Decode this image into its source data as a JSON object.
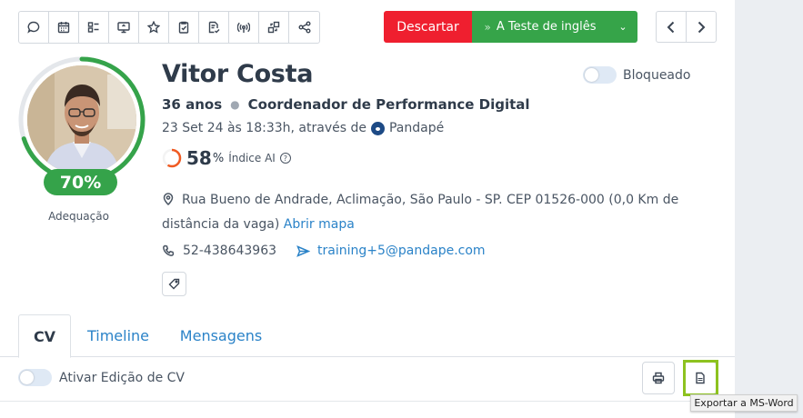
{
  "toolbar": {
    "icons": [
      "chat-icon",
      "calendar-icon",
      "checklist-icon",
      "screen-share-icon",
      "star-icon",
      "clipboard-check-icon",
      "document-check-icon",
      "signal-icon",
      "transfer-icon",
      "share-icon"
    ]
  },
  "actions": {
    "discard_label": "Descartar",
    "advance_label": "A Teste de inglês"
  },
  "candidate": {
    "name": "Vitor Costa",
    "age": "36 anos",
    "role": "Coordenador de Performance Digital",
    "applied_prefix": "23 Set 24 às 18:33h, através de",
    "source": "Pandapé",
    "ai_score": "58",
    "ai_unit": "%",
    "ai_label": "Índice AI",
    "fit_score": "70%",
    "fit_fraction": 0.7,
    "fit_label": "Adequação",
    "blocked_label": "Bloqueado",
    "address": "Rua Bueno de Andrade, Aclimação, São Paulo - SP. CEP 01526-000 (0,0 Km de distância da vaga)",
    "map_link": "Abrir mapa",
    "phone": "52-438643963",
    "email": "training+5@pandape.com"
  },
  "tabs": [
    {
      "label": "CV"
    },
    {
      "label": "Timeline"
    },
    {
      "label": "Mensagens"
    }
  ],
  "cv": {
    "edit_toggle_label": "Ativar Edição de CV"
  },
  "tooltip": {
    "text": "Exportar a MS-Word"
  },
  "colors": {
    "discard": "#ef1f2f",
    "advance": "#36a449",
    "link": "#2b83c8",
    "highlight": "#8dc21f"
  }
}
